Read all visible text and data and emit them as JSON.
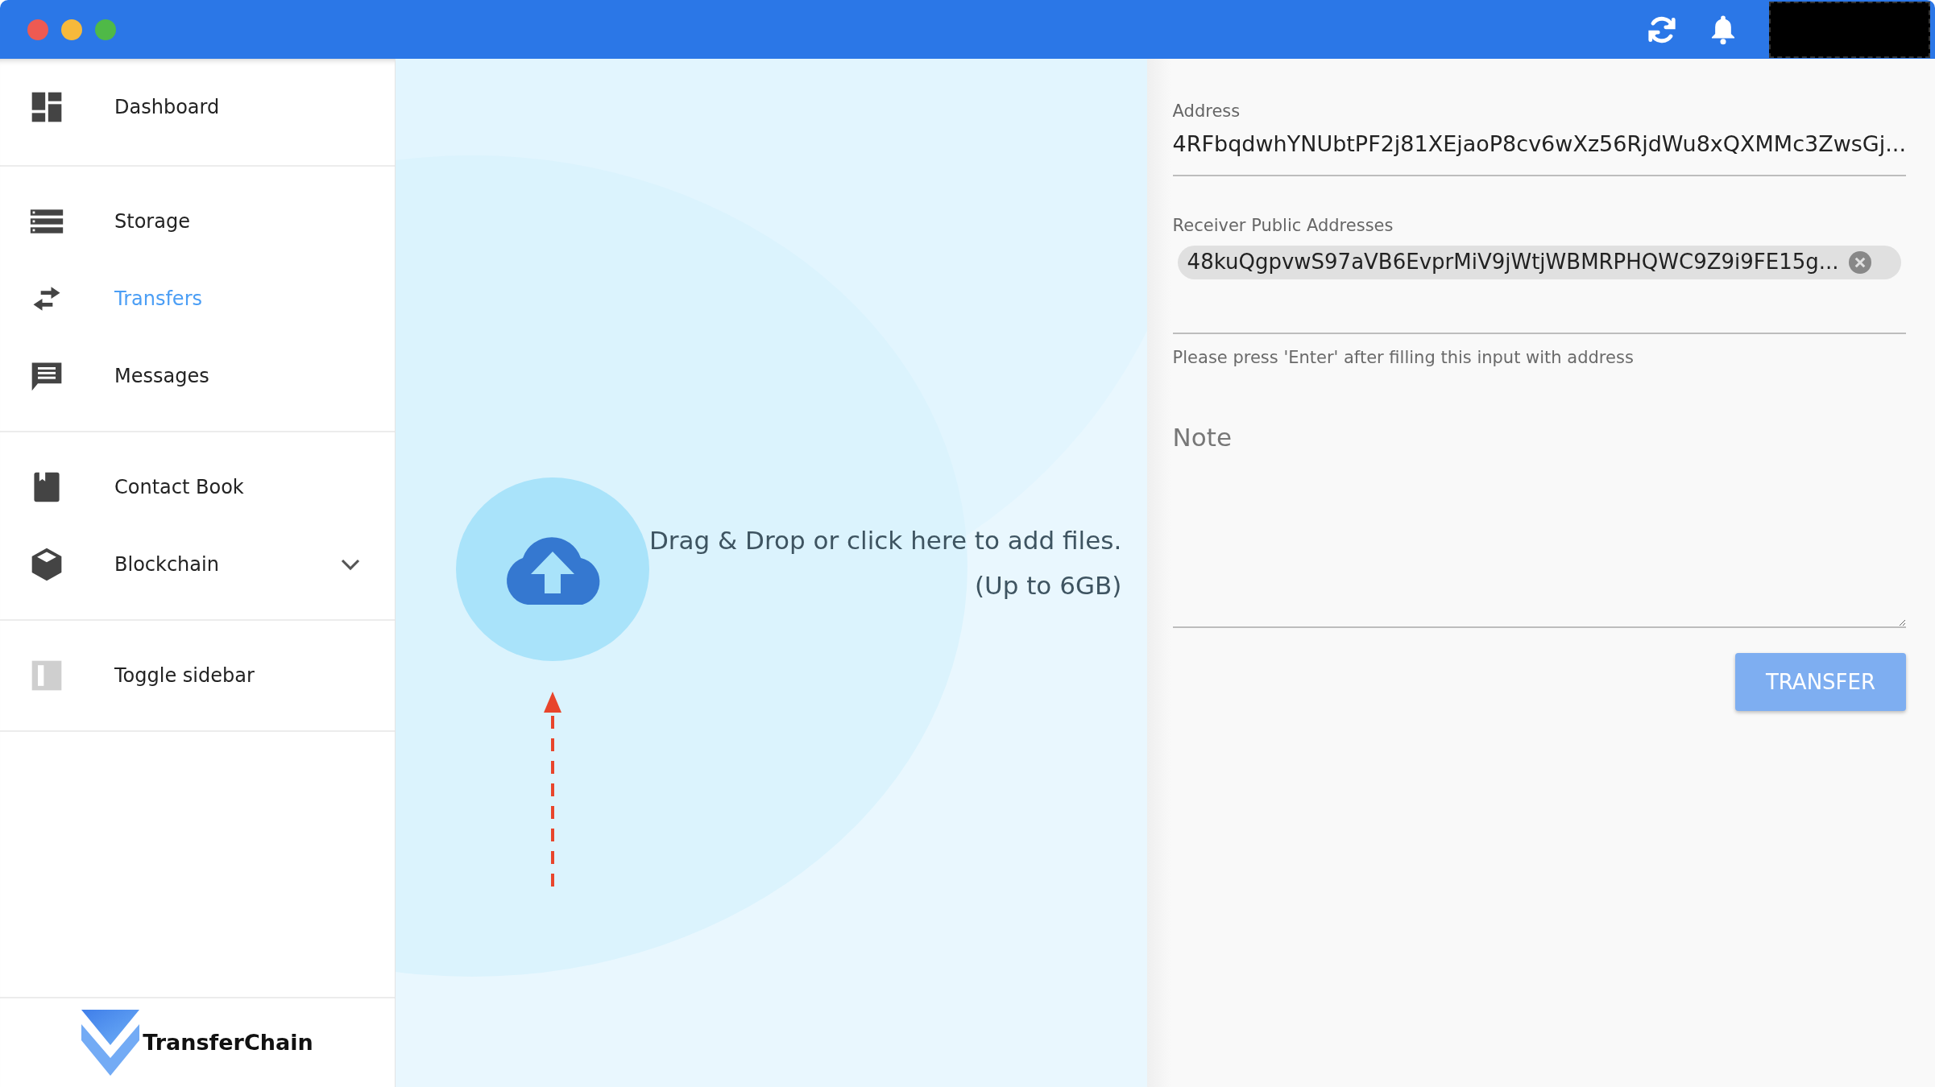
{
  "sidebar": {
    "sections": [
      {
        "items": [
          {
            "label": "Dashboard",
            "selected": false
          }
        ]
      },
      {
        "items": [
          {
            "label": "Storage",
            "selected": false
          },
          {
            "label": "Transfers",
            "selected": true
          },
          {
            "label": "Messages",
            "selected": false
          }
        ]
      },
      {
        "items": [
          {
            "label": "Contact Book",
            "selected": false
          },
          {
            "label": "Blockchain",
            "selected": false,
            "expanded": false
          }
        ]
      },
      {
        "items": [
          {
            "label": "Toggle sidebar",
            "selected": false
          }
        ]
      }
    ],
    "logo": "TransferChain"
  },
  "dropzone": {
    "lines": [
      "Drag & Drop or click here to add files.",
      "(Up to 6GB)"
    ]
  },
  "form": {
    "address": {
      "label": "Address",
      "value": "4RFbqdwhYNUbtPF2j81XEjaoP8cv6wXz56RjdWu8xQXMMc3ZwsGj..."
    },
    "receivers": {
      "label": "Receiver Public Addresses",
      "chips": [
        "48kuQgpvwS97aVB6EvprMiV9jWtjWBMRPHQWC9Z9i9FE15g..."
      ],
      "hint": "Please press 'Enter' after filling this input with address"
    },
    "note": {
      "placeholder": "Note"
    },
    "submit": {
      "label": "TRANSFER",
      "disabled": true
    }
  }
}
